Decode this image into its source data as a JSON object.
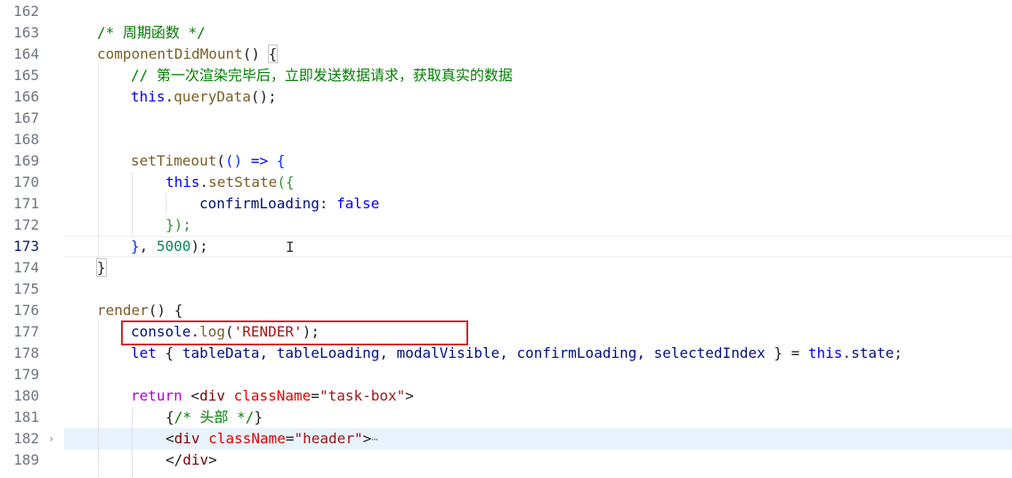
{
  "editor": {
    "active_line": "173",
    "line_numbers": [
      "162",
      "163",
      "164",
      "165",
      "166",
      "167",
      "168",
      "169",
      "170",
      "171",
      "172",
      "173",
      "174",
      "175",
      "176",
      "177",
      "178",
      "179",
      "180",
      "181",
      "182",
      "189"
    ],
    "folded_line_chevron": "›",
    "ellipsis": "⋯",
    "cursor_glyph": "I",
    "lines": {
      "l163": {
        "comment": "/* 周期函数 */"
      },
      "l164": {
        "fn": "componentDidMount",
        "parens": "()",
        "brace": "{"
      },
      "l165": {
        "comment": "// 第一次渲染完毕后，立即发送数据请求，获取真实的数据"
      },
      "l166": {
        "kw": "this",
        "dot": ".",
        "fn": "queryData",
        "rest": "();"
      },
      "l169": {
        "fn": "setTimeout",
        "open": "(",
        "parens": "()",
        "arrow": " => ",
        "brace": "{"
      },
      "l170": {
        "kw": "this",
        "dot": ".",
        "fn": "setState",
        "open": "(",
        "brace": "{"
      },
      "l171": {
        "prop": "confirmLoading",
        "colon": ": ",
        "value": "false"
      },
      "l172": {
        "brace": "}",
        "close": ");"
      },
      "l173": {
        "brace": "}",
        "comma": ", ",
        "num": "5000",
        "close": ");"
      },
      "l174": {
        "brace": "}"
      },
      "l176": {
        "fn": "render",
        "parens": "()",
        "sp": " ",
        "brace": "{"
      },
      "l177": {
        "obj": "console",
        "dot": ".",
        "fn": "log",
        "open": "(",
        "str": "'RENDER'",
        "close": ");"
      },
      "l178": {
        "kw": "let",
        "open": " { ",
        "vars": "tableData, tableLoading, modalVisible, confirmLoading, selectedIndex",
        "close": " } = ",
        "this": "this",
        "dot": ".",
        "prop": "state",
        "semi": ";"
      },
      "l180": {
        "kw": "return",
        "lt": " <",
        "tag": "div",
        "attr": " className",
        "eq": "=",
        "str": "\"task-box\"",
        "gt": ">"
      },
      "l181": {
        "open": "{",
        "comment": "/* 头部 */",
        "close": "}"
      },
      "l182": {
        "lt": "<",
        "tag": "div",
        "attr": " className",
        "eq": "=",
        "str": "\"header\"",
        "gt": ">"
      },
      "l189": {
        "lt": "</",
        "tag": "div",
        "gt": ">"
      }
    }
  },
  "annotation": {
    "highlight_color": "#d9232a",
    "highlighted_line": "177"
  }
}
